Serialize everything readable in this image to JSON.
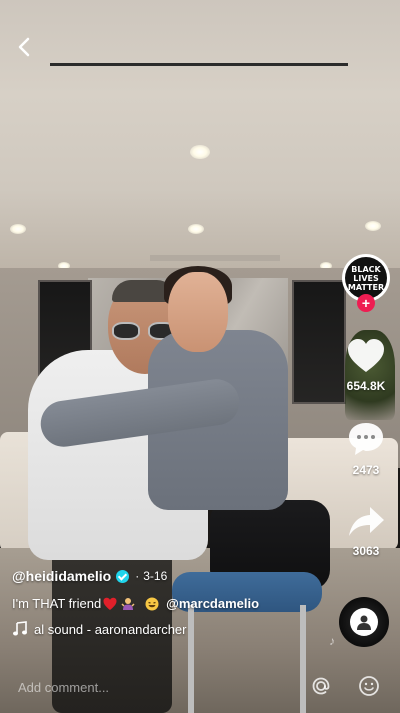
{
  "caption": {
    "username": "@heididamelio",
    "separator": "·",
    "date": "3-16",
    "text_before": "I'm THAT friend",
    "mention": "@marcdamelio"
  },
  "sound": {
    "label": "al sound - aaronandarcher"
  },
  "side_rail": {
    "avatar_text": [
      "BLACK",
      "LIVES",
      "MATTER"
    ],
    "follow_label": "+",
    "likes": "654.8K",
    "comments": "2473",
    "shares": "3063"
  },
  "comment_bar": {
    "placeholder": "Add comment..."
  },
  "colors": {
    "like_red": "#ee1d52",
    "verified_cyan": "#20d5ec",
    "text_white": "#ffffff"
  },
  "icons": {
    "back": "back-chevron-icon",
    "like": "heart-icon",
    "comment": "comment-bubble-icon",
    "share": "share-arrow-icon",
    "note": "music-note-icon",
    "mention": "at-sign-icon",
    "emoji": "smiley-icon"
  }
}
